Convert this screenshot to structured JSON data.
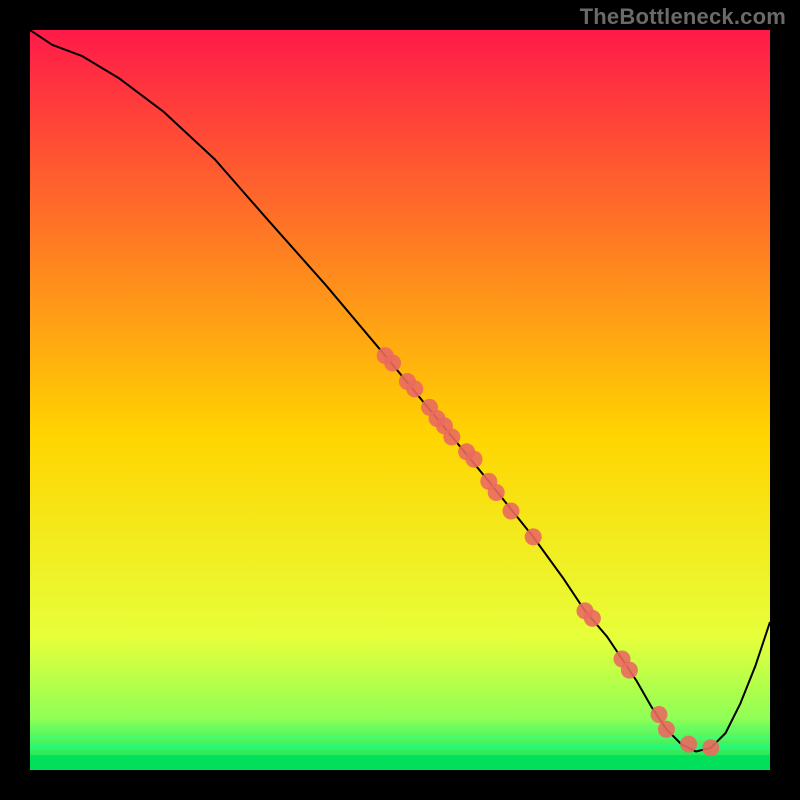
{
  "watermark": "TheBottleneck.com",
  "chart_data": {
    "type": "line",
    "title": "",
    "xlabel": "",
    "ylabel": "",
    "xlim": [
      0,
      100
    ],
    "ylim": [
      0,
      100
    ],
    "background_gradient": {
      "top": "#ff1a49",
      "mid": "#ffd500",
      "bottom": "#00e05a"
    },
    "curve": {
      "x": [
        0,
        3,
        7,
        12,
        18,
        25,
        32,
        40,
        48,
        55,
        62,
        68,
        72,
        75,
        78,
        80,
        82,
        84,
        86,
        88,
        90,
        92,
        94,
        96,
        98,
        100
      ],
      "y": [
        100,
        98,
        96.5,
        93.5,
        89,
        82.5,
        74.5,
        65.5,
        56,
        47.5,
        39,
        31.5,
        26,
        21.5,
        18,
        15,
        12,
        8.5,
        5.5,
        3.5,
        2.5,
        3,
        5,
        9,
        14,
        20
      ]
    },
    "points": {
      "x": [
        48,
        49,
        51,
        52,
        54,
        55,
        56,
        57,
        59,
        60,
        62,
        63,
        65,
        68,
        75,
        76,
        80,
        81,
        85,
        86,
        89,
        92
      ],
      "y": [
        56,
        55,
        52.5,
        51.5,
        49,
        47.5,
        46.5,
        45,
        43,
        42,
        39,
        37.5,
        35,
        31.5,
        21.5,
        20.5,
        15,
        13.5,
        7.5,
        5.5,
        3.5,
        3
      ]
    }
  }
}
